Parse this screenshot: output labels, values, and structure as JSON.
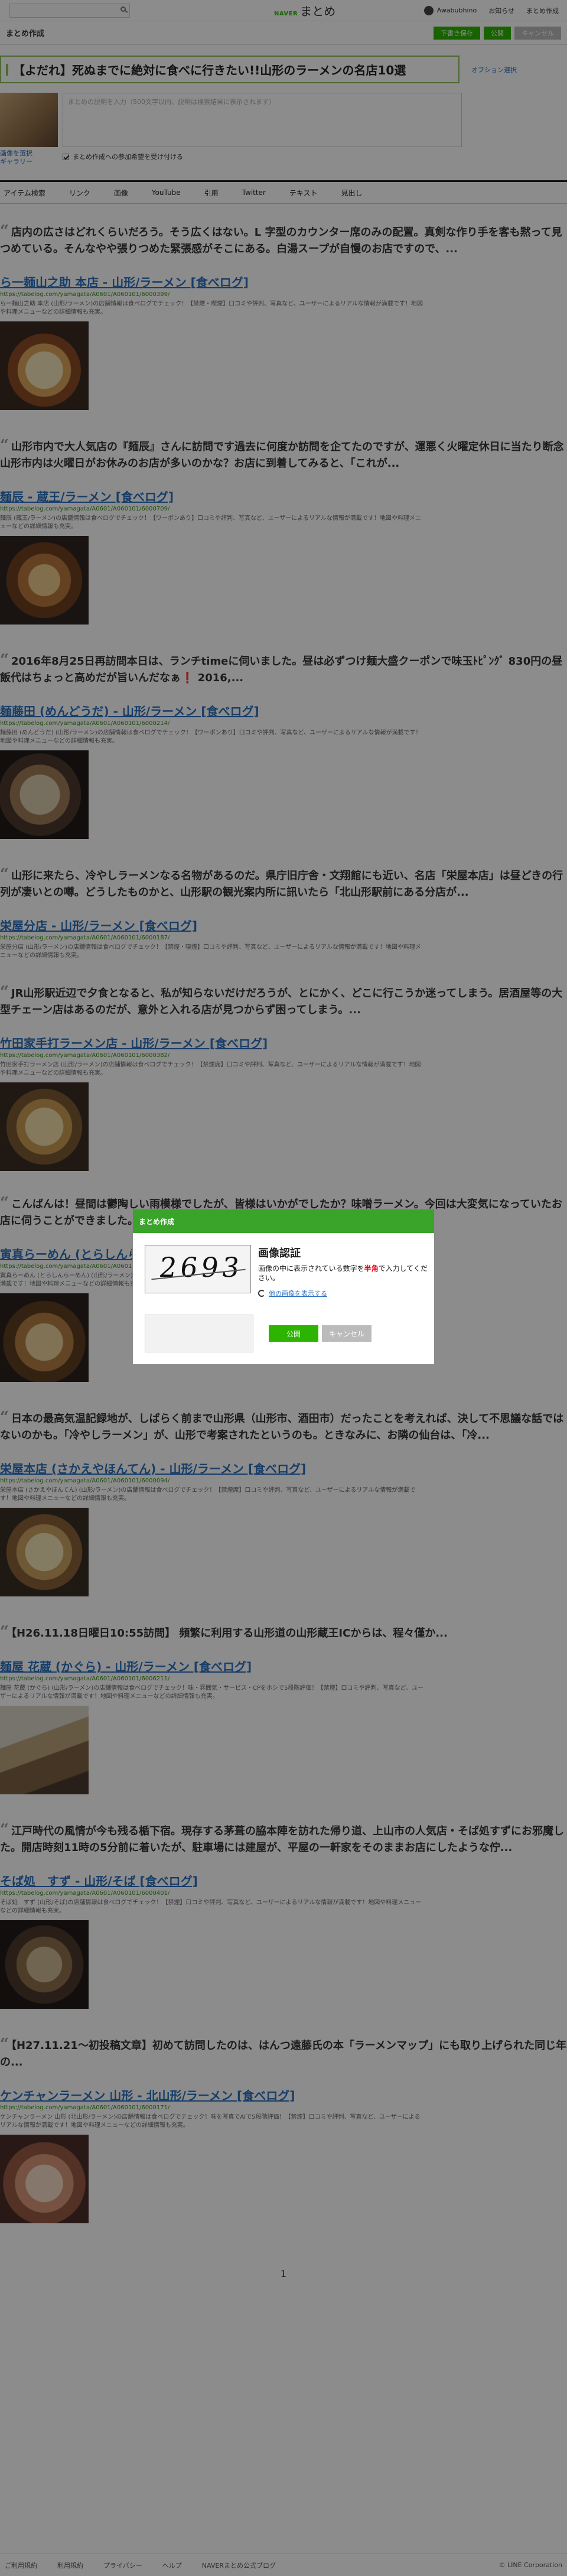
{
  "header": {
    "logo_brand": "NAVER",
    "logo_name": "まとめ",
    "username": "Awabubhino",
    "notifications": "お知らせ",
    "my_matome": "まとめ作成"
  },
  "subbar": {
    "title": "まとめ作成",
    "draft_button": "下書き保存",
    "publish_button": "公開",
    "cancel_button": "キャンセル"
  },
  "article": {
    "title": "【よだれ】死ぬまでに絶対に食べに行きたい!!山形のラーメンの名店10選",
    "option_label": "オプション選択",
    "thumbnail_links": [
      "画像を選択",
      "ギャラリー"
    ],
    "description_placeholder": "まとめの説明を入力（500文字以内、説明は検索結果に表示されます）",
    "allow_invites_label": "まとめ作成への参加希望を受け付ける"
  },
  "toolbar": {
    "items": [
      "アイテム検索",
      "リンク",
      "画像",
      "YouTube",
      "引用",
      "Twitter",
      "テキスト",
      "見出し"
    ]
  },
  "items": [
    {
      "quote": "店内の広さはどれくらいだろう。そう広くはない。L 字型のカウンター席のみの配置。真剣な作り手を客も黙って見つめている。そんなやや張りつめた緊張感がそこにある。白湯スープが自慢のお店ですので、...",
      "title": "ら一麺山之助 本店 - 山形/ラーメン [食べログ]",
      "url": "https://tabelog.com/yamagata/A0601/A060101/6000399/",
      "desc": "ら一麺山之助 本店 (山形/ラーメン)の店舗情報は食べログでチェック！【禁煙・喫煙】口コミや評判、写真など、ユーザーによるリアルな情報が満載です！地図や料理メニューなどの詳細情報も充実。"
    },
    {
      "quote": "山形市内で大人気店の『麺辰』さんに訪問です過去に何度か訪問を企てたのですが、運悪く火曜定休日に当たり断念山形市内は火曜日がお休みのお店が多いのかな？お店に到着してみると、「これが...",
      "title": "麺辰 - 蔵王/ラーメン [食べログ]",
      "url": "https://tabelog.com/yamagata/A0601/A060101/6000709/",
      "desc": "麺辰 (蔵王/ラーメン)の店舗情報は食べログでチェック！【ワーポンあり】口コミや評判、写真など、ユーザーによるリアルな情報が満載です！地図や料理メニューなどの詳細情報も充実。"
    },
    {
      "quote": "2016年8月25日再訪問本日は、ランチtimeに伺いました。昼は必ずつけ麺大盛クーポンで味玉ﾄﾋﾟﾝｸﾞ 830円の昼飯代はちょっと高めだが旨いんだなぁ❗ 2016,...",
      "title": "麺藤田 (めんどうだ) - 山形/ラーメン [食べログ]",
      "url": "https://tabelog.com/yamagata/A0601/A060101/6000214/",
      "desc": "麺藤田 (めんどうだ) (山形/ラーメン)の店舗情報は食べログでチェック！【ワーポンあり】口コミや評判、写真など、ユーザーによるリアルな情報が満載です！地図や料理メニューなどの詳細情報も充実。"
    },
    {
      "quote": "山形に来たら、冷やしラーメンなる名物があるのだ。県庁旧庁舎・文翔館にも近い、名店「栄屋本店」は昼どきの行列が凄いとの噂。どうしたものかと、山形駅の観光案内所に訊いたら「北山形駅前にある分店が...",
      "title": "栄屋分店 - 山形/ラーメン [食べログ]",
      "url": "https://tabelog.com/yamagata/A0601/A060101/6000187/",
      "desc": "栄屋分店 (山形/ラーメン)の店舗情報は食べログでチェック！【禁煙・喫煙】口コミや評判、写真など、ユーザーによるリアルな情報が満載です！地図や料理メニューなどの詳細情報も充実。"
    },
    {
      "quote": "JR山形駅近辺で夕食となると、私が知らないだけだろうが、とにかく、どこに行こうか迷ってしまう。居酒屋等の大型チェーン店はあるのだが、意外と入れる店が見つからず困ってしまう。...",
      "title": "竹田家手打ラーメン店 - 山形/ラーメン [食べログ]",
      "url": "https://tabelog.com/yamagata/A0601/A060101/6000382/",
      "desc": "竹田家手打ラーメン店 (山形/ラーメン)の店舗情報は食べログでチェック！【禁煙席】口コミや評判、写真など、ユーザーによるリアルな情報が満載です！地図や料理メニューなどの詳細情報も充実。"
    },
    {
      "quote": "こんばんは！昼間は鬱陶しい雨模様でしたが、皆様はいかがでしたか？味噌ラーメン。今回は大変気になっていたお店に伺うことができました。お店の前までやってきました...",
      "title": "寅真らーめん (とらしんらーめん) - 山形/ラーメン [食べログ]",
      "url": "https://tabelog.com/yamagata/A0601/A060101/6003117/",
      "desc": "寅真らーめん (とらしんらーめん) (山形/ラーメン)の店舗情報は食べログでチェック！【禁煙・喫煙】口コミや評判、写真など、ユーザーによるリアルな情報が満載です！地図や料理メニューなどの詳細情報も充実。"
    },
    {
      "quote": "日本の最高気温記録地が、しばらく前まで山形県（山形市、酒田市）だったことを考えれば、決して不思議な話ではないのかも。「冷やしラーメン」が、山形で考案されたというのも。ときなみに、お隣の仙台は、「冷...",
      "title": "栄屋本店 (さかえやほんてん) - 山形/ラーメン [食べログ]",
      "url": "https://tabelog.com/yamagata/A0601/A060101/6000094/",
      "desc": "栄屋本店 (さかえやほんてん) (山形/ラーメン)の店舗情報は食べログでチェック！【禁煙席】口コミや評判、写真など、ユーザーによるリアルな情報が満載です！地図や料理メニューなどの詳細情報も充実。"
    },
    {
      "quote": "【H26.11.18日曜日10:55訪問】 頻繁に利用する山形道の山形蔵王ICからは、程々僅か...",
      "title": "麺屋 花蔵 (かぐら) - 山形/ラーメン [食べログ]",
      "url": "https://tabelog.com/yamagata/A0601/A060101/6006211/",
      "desc": "麺屋 花蔵 (かぐら) (山形/ラーメン)の店舗情報は食べログでチェック！味・雰囲気・サービス・CPをホシで5段階評価！【禁煙】口コミや評判、写真など、ユーザーによるリアルな情報が満載です！地図や料理メニューなどの詳細情報も充実。"
    },
    {
      "quote": "江戸時代の風情が今も残る楯下宿。現存する茅葺の脇本陣を訪れた帰り道、上山市の人気店・そば処すずにお邪魔した。開店時刻11時の5分前に着いたが、駐車場には建屋が、平屋の一軒家をそのままお店にしたような佇...",
      "title": "そば処　すず - 山形/そば [食べログ]",
      "url": "https://tabelog.com/yamagata/A0601/A060101/6000401/",
      "desc": "そば処　すず (山形/そば)の店舗情報は食べログでチェック！【禁煙】口コミや評判、写真など、ユーザーによるリアルな情報が満載です！地図や料理メニューなどの詳細情報も充実。"
    },
    {
      "quote": "【H27.11.21〜初投稿文章】初めて訪問したのは、はんつ遠藤氏の本「ラーメンマップ」にも取り上げられた同じ年の...",
      "title": "ケンチャンラーメン 山形 - 北山形/ラーメン [食べログ]",
      "url": "https://tabelog.com/yamagata/A0601/A060101/6000171/",
      "desc": "ケンチャンラーメン 山形 (北山形/ラーメン)の店舗情報は食べログでチェック！味を写真でAIで5段階評価！【禁煙】口コミや評判、写真など、ユーザーによるリアルな情報が満載です！地図や料理メニューなどの詳細情報も充実。"
    }
  ],
  "pager": {
    "page": "1"
  },
  "footer": {
    "links": [
      "ご利用規約",
      "利用規約",
      "プライバシー",
      "ヘルプ",
      "NAVERまとめ公式ブログ"
    ],
    "copyright": "© LINE Corporation"
  },
  "modal": {
    "header": "まとめ作成",
    "captcha_code": "2693",
    "heading": "画像認証",
    "text_before": "画像の中に表示されている数字を",
    "text_required": "半角",
    "text_after": "で入力してください。",
    "refresh_label": "他の画像を表示する",
    "input_value": "",
    "submit_label": "公開",
    "cancel_label": "キャンセル"
  }
}
